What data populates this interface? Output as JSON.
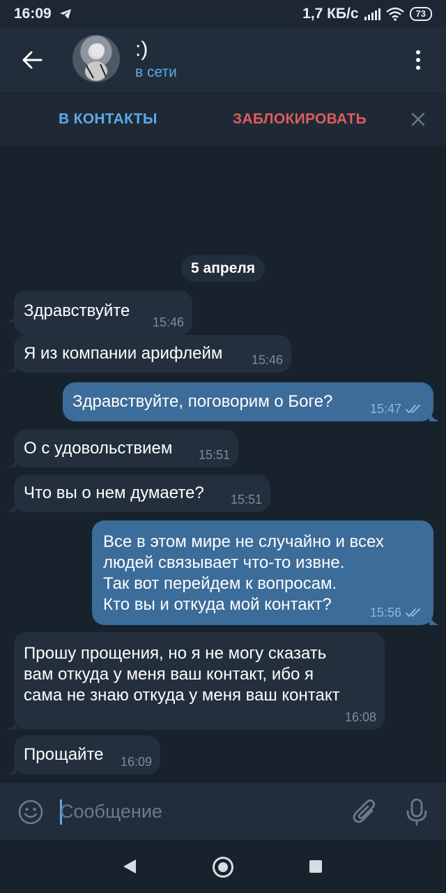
{
  "statusbar": {
    "time": "16:09",
    "net_speed": "1,7 КБ/с",
    "battery": "73"
  },
  "header": {
    "title": ":)",
    "status": "в сети"
  },
  "actions": {
    "add_contact": "В КОНТАКТЫ",
    "block": "ЗАБЛОКИРОВАТЬ"
  },
  "date_separator": "5 апреля",
  "messages": [
    {
      "dir": "in",
      "text": "Здравствуйте",
      "time": "15:46"
    },
    {
      "dir": "in",
      "text": "Я из компании арифлейм",
      "time": "15:46"
    },
    {
      "dir": "out",
      "text": "Здравствуйте, поговорим о Боге?",
      "time": "15:47",
      "read": true
    },
    {
      "dir": "in",
      "text": "О с удовольствием",
      "time": "15:51"
    },
    {
      "dir": "in",
      "text": "Что вы о нем думаете?",
      "time": "15:51"
    },
    {
      "dir": "out",
      "text": "Все в этом мире не случайно и всех\nлюдей связывает что-то извне.\nТак вот перейдем к вопросам.\nКто вы и откуда мой контакт?",
      "time": "15:56",
      "read": true
    },
    {
      "dir": "in",
      "text": "Прошу прощения, но я не могу сказать\nвам откуда у меня ваш контакт, ибо я\nсама не знаю откуда у меня ваш контакт",
      "time": "16:08"
    },
    {
      "dir": "in",
      "text": "Прощайте",
      "time": "16:09"
    }
  ],
  "input": {
    "placeholder": "Сообщение"
  },
  "colors": {
    "accent": "#5ea8ea",
    "danger": "#e05c5c",
    "outgoing_bubble": "#3c6c99",
    "incoming_bubble": "#232f3d",
    "background": "#18222d"
  }
}
